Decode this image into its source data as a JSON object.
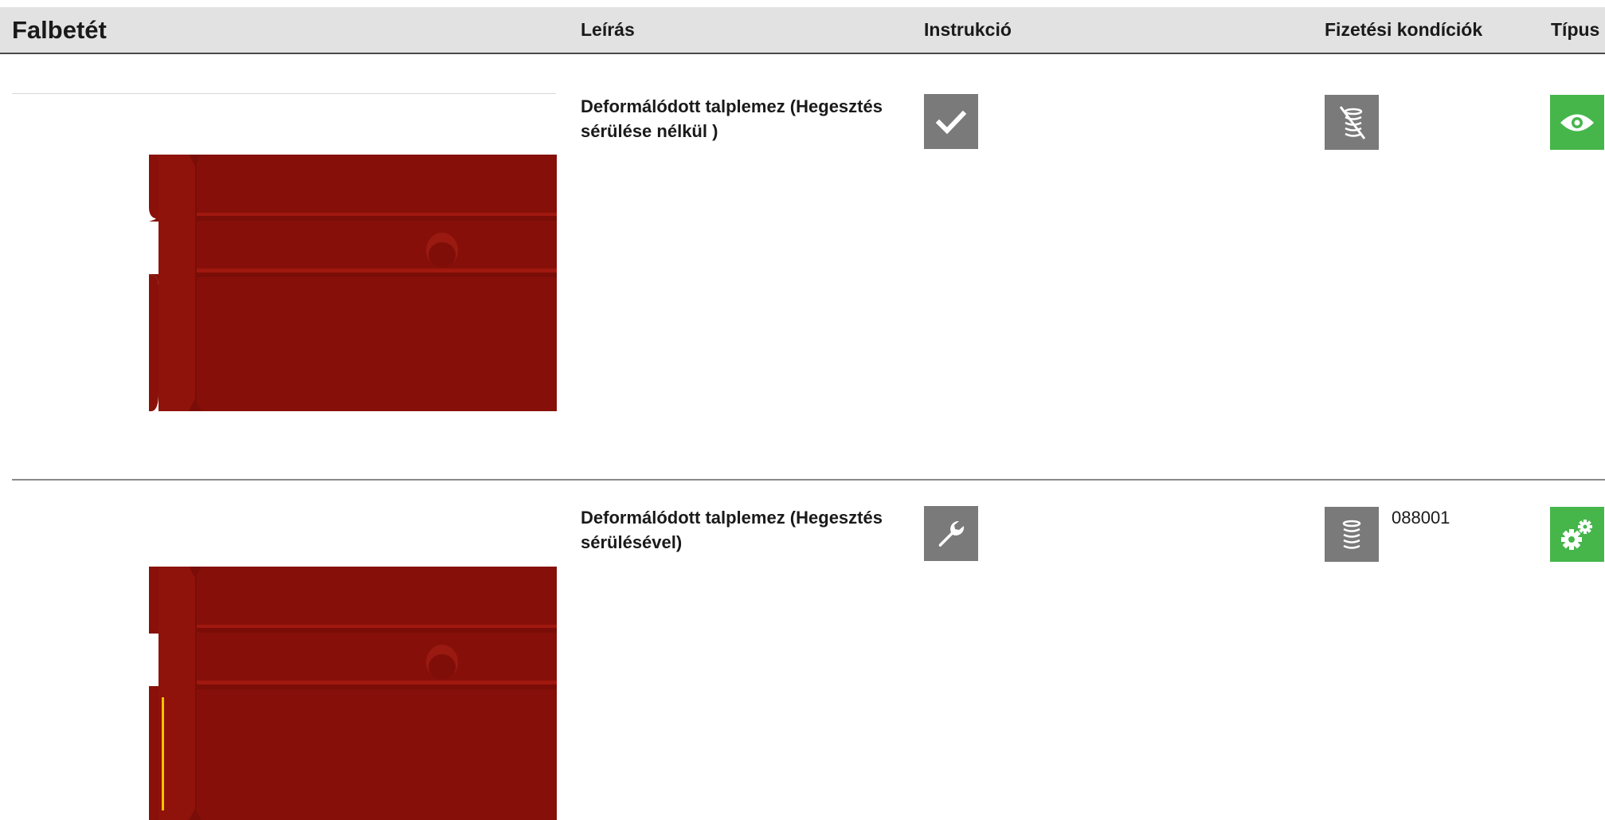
{
  "header": {
    "title": "Falbetét",
    "col_description": "Leírás",
    "col_instruction": "Instrukció",
    "col_payment": "Fizetési kondíciók",
    "col_type": "Típus"
  },
  "rows": [
    {
      "description": "Deformálódott talplemez (Hegesztés sérülése nélkül )",
      "instruction_icon": "checkmark-icon",
      "payment_icon": "coins-crossed-icon",
      "payment_code": "",
      "type_icon": "eye-icon"
    },
    {
      "description": "Deformálódott talplemez (Hegesztés sérülésével)",
      "instruction_icon": "wrench-icon",
      "payment_icon": "coins-icon",
      "payment_code": "088001",
      "type_icon": "gears-icon"
    }
  ],
  "colors": {
    "header_bg": "#e2e2e2",
    "icon_gray": "#7a7a7a",
    "icon_green": "#46b64b",
    "part_red": "#861009",
    "weld_highlight": "#f5c400"
  }
}
